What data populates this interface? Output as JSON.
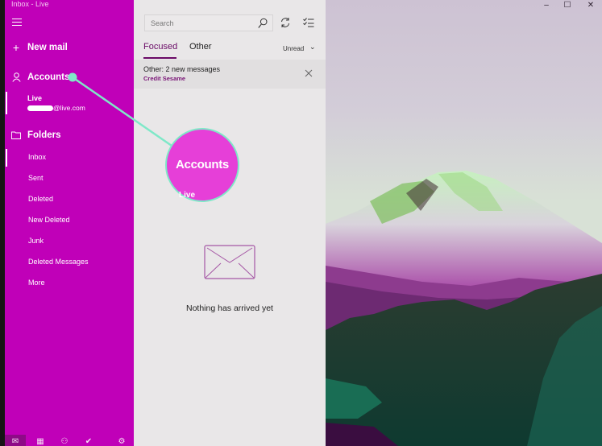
{
  "window": {
    "title": "Inbox - Live",
    "controls": {
      "minimize": "–",
      "maximize": "☐",
      "close": "✕"
    }
  },
  "sidebar": {
    "accent_color": "#c000b8",
    "menu_icon": "hamburger-icon",
    "new_mail": {
      "icon": "+",
      "label": "New mail"
    },
    "accounts": {
      "icon": "person-icon",
      "label": "Accounts"
    },
    "account": {
      "name": "Live",
      "email_suffix": "@live.com"
    },
    "folders_header": {
      "icon": "folder-icon",
      "label": "Folders"
    },
    "folders": [
      {
        "label": "Inbox",
        "selected": true
      },
      {
        "label": "Sent",
        "selected": false
      },
      {
        "label": "Deleted",
        "selected": false
      },
      {
        "label": "New Deleted",
        "selected": false
      },
      {
        "label": "Junk",
        "selected": false
      },
      {
        "label": "Deleted Messages",
        "selected": false
      },
      {
        "label": "More",
        "selected": false
      }
    ],
    "bottom_nav": [
      {
        "icon": "mail-icon",
        "glyph": "✉",
        "active": true
      },
      {
        "icon": "calendar-icon",
        "glyph": "▦",
        "active": false
      },
      {
        "icon": "people-icon",
        "glyph": "⚇",
        "active": false
      },
      {
        "icon": "todo-icon",
        "glyph": "✔",
        "active": false
      },
      {
        "icon": "settings-icon",
        "glyph": "⚙",
        "active": false
      }
    ]
  },
  "message_list": {
    "search_placeholder": "Search",
    "tabs": [
      {
        "label": "Focused",
        "active": true
      },
      {
        "label": "Other",
        "active": false
      }
    ],
    "filter": {
      "label": "Unread",
      "chevron": "⌄"
    },
    "notice": {
      "title": "Other: 2 new messages",
      "sender": "Credit Sesame"
    },
    "empty_state": "Nothing has arrived yet"
  },
  "callout": {
    "label": "Accounts",
    "sub_label": "Live",
    "color": "#7fe8c8"
  }
}
